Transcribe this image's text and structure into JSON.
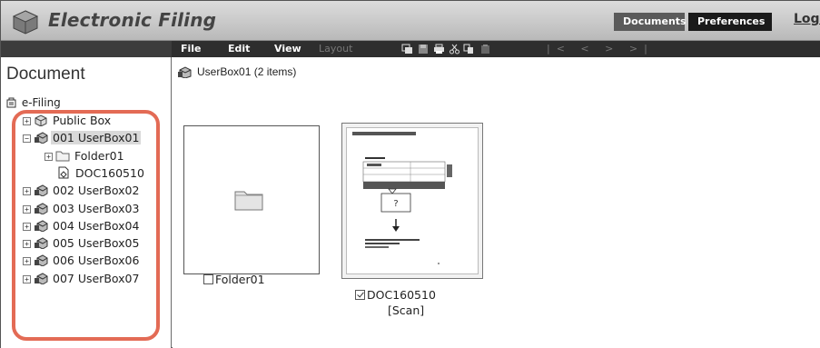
{
  "header": {
    "app_title": "Electronic Filing",
    "tab_documents": "Documents",
    "tab_preferences": "Preferences",
    "login_link": "Logi"
  },
  "left": {
    "heading": "Document",
    "root_label": "e-Filing",
    "tree": [
      {
        "label": "Public Box",
        "expander": "+",
        "icon": "public-box-icon",
        "indent": 0,
        "selected": false
      },
      {
        "label": "001 UserBox01",
        "expander": "−",
        "icon": "user-box-icon",
        "indent": 0,
        "selected": true
      },
      {
        "label": "Folder01",
        "expander": "+",
        "icon": "folder-icon",
        "indent": 1,
        "selected": false
      },
      {
        "label": "DOC160510",
        "expander": "",
        "icon": "document-icon",
        "indent": 2,
        "selected": false
      },
      {
        "label": "002 UserBox02",
        "expander": "+",
        "icon": "user-box-icon",
        "indent": 0,
        "selected": false
      },
      {
        "label": "003 UserBox03",
        "expander": "+",
        "icon": "user-box-icon",
        "indent": 0,
        "selected": false
      },
      {
        "label": "004 UserBox04",
        "expander": "+",
        "icon": "user-box-icon",
        "indent": 0,
        "selected": false
      },
      {
        "label": "005 UserBox05",
        "expander": "+",
        "icon": "user-box-icon",
        "indent": 0,
        "selected": false
      },
      {
        "label": "006 UserBox06",
        "expander": "+",
        "icon": "user-box-icon",
        "indent": 0,
        "selected": false
      },
      {
        "label": "007 UserBox07",
        "expander": "+",
        "icon": "user-box-icon",
        "indent": 0,
        "selected": false
      }
    ]
  },
  "toolbar": {
    "menu_file": "File",
    "menu_edit": "Edit",
    "menu_view": "View",
    "menu_layout": "Layout",
    "icons": [
      "retrieve-icon",
      "save-icon",
      "print-icon",
      "cut-icon",
      "copy-icon",
      "paste-icon"
    ],
    "nav_arrows": "|< < > >|"
  },
  "main": {
    "path_label": "UserBox01",
    "item_count": "(2 items)",
    "items": [
      {
        "name": "Folder01",
        "checked": false
      },
      {
        "name": "DOC160510",
        "sub": "[Scan]",
        "checked": true
      }
    ],
    "doc_preview_question": "?"
  },
  "colors": {
    "highlight_ring": "#e36b55",
    "toolbar_bg": "#2e2e2e",
    "header_bg": "#c8c8c8"
  }
}
